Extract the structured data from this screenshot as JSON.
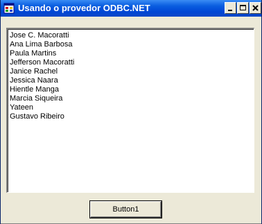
{
  "window": {
    "title": "Usando o provedor ODBC.NET"
  },
  "titlebar_buttons": {
    "minimize": "minimize",
    "maximize": "maximize",
    "close": "close"
  },
  "listbox": {
    "items": [
      "Jose C. Macoratti",
      "Ana Lima Barbosa",
      "Paula Martins",
      "Jefferson Macoratti",
      "Janice Rachel",
      "Jessica Naara",
      "Hientle Manga",
      "Marcia Siqueira",
      "Yateen",
      "Gustavo Ribeiro"
    ]
  },
  "button": {
    "label": "Button1"
  },
  "colors": {
    "titlebar": "#0a5ee0",
    "face": "#ece9d8"
  }
}
